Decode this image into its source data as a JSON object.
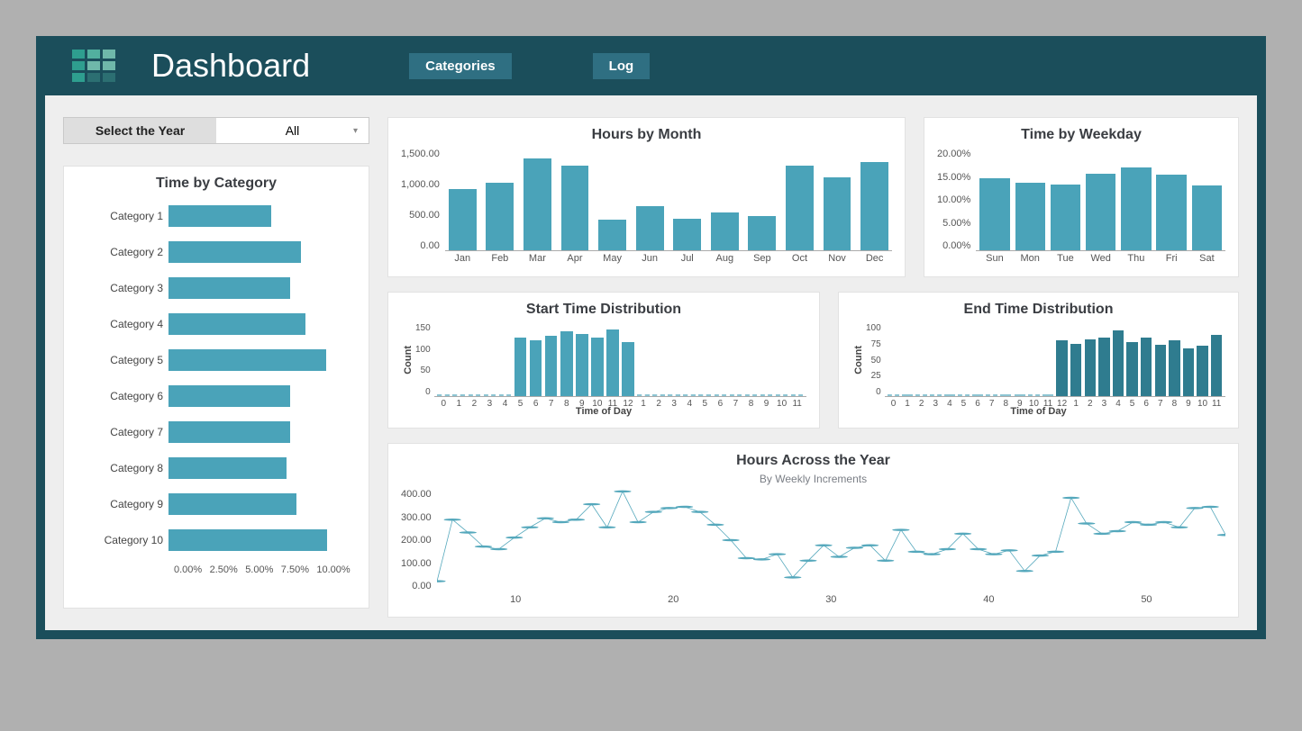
{
  "header": {
    "title": "Dashboard",
    "nav": {
      "categories": "Categories",
      "log": "Log"
    }
  },
  "selector": {
    "label": "Select the Year",
    "value": "All"
  },
  "colors": {
    "bar": "#4aa3b9",
    "bar_dark": "#2f7c8f",
    "line": "#55a8bc"
  },
  "chart_data": [
    {
      "id": "time_by_category",
      "type": "bar",
      "orientation": "horizontal",
      "title": "Time by Category",
      "xlabel": "",
      "ylabel": "",
      "xlim": [
        0,
        12.5
      ],
      "x_ticks": [
        "0.00%",
        "2.50%",
        "5.00%",
        "7.50%",
        "10.00%"
      ],
      "categories": [
        "Category 1",
        "Category 2",
        "Category 3",
        "Category 4",
        "Category 5",
        "Category 6",
        "Category 7",
        "Category 8",
        "Category 9",
        "Category 10"
      ],
      "values": [
        7.0,
        9.0,
        8.3,
        9.3,
        10.7,
        8.3,
        8.3,
        8.0,
        8.7,
        10.8
      ]
    },
    {
      "id": "hours_by_month",
      "type": "bar",
      "title": "Hours by Month",
      "xlabel": "",
      "ylabel": "",
      "ylim": [
        0,
        1500
      ],
      "y_ticks": [
        "1,500.00",
        "1,000.00",
        "500.00",
        "0.00"
      ],
      "categories": [
        "Jan",
        "Feb",
        "Mar",
        "Apr",
        "May",
        "Jun",
        "Jul",
        "Aug",
        "Sep",
        "Oct",
        "Nov",
        "Dec"
      ],
      "values": [
        900,
        1000,
        1350,
        1250,
        450,
        650,
        470,
        560,
        510,
        1250,
        1070,
        1300
      ]
    },
    {
      "id": "time_by_weekday",
      "type": "bar",
      "title": "Time by Weekday",
      "xlabel": "",
      "ylabel": "",
      "ylim": [
        0,
        20
      ],
      "y_ticks": [
        "20.00%",
        "15.00%",
        "10.00%",
        "5.00%",
        "0.00%"
      ],
      "categories": [
        "Sun",
        "Mon",
        "Tue",
        "Wed",
        "Thu",
        "Fri",
        "Sat"
      ],
      "values": [
        14.2,
        13.3,
        12.9,
        15.0,
        16.2,
        14.9,
        12.7
      ]
    },
    {
      "id": "start_time_distribution",
      "type": "bar",
      "title": "Start Time Distribution",
      "xlabel": "Time of Day",
      "ylabel": "Count",
      "ylim": [
        0,
        175
      ],
      "y_ticks": [
        "150",
        "100",
        "50",
        "0"
      ],
      "categories": [
        "0",
        "1",
        "2",
        "3",
        "4",
        "5",
        "6",
        "7",
        "8",
        "9",
        "10",
        "11",
        "12",
        "1",
        "2",
        "3",
        "4",
        "5",
        "6",
        "7",
        "8",
        "9",
        "10",
        "11"
      ],
      "values": [
        0,
        0,
        0,
        0,
        0,
        140,
        135,
        145,
        155,
        150,
        140,
        160,
        130,
        0,
        0,
        0,
        0,
        0,
        0,
        0,
        0,
        0,
        0,
        0
      ]
    },
    {
      "id": "end_time_distribution",
      "type": "bar",
      "title": "End Time Distribution",
      "xlabel": "Time of Day",
      "ylabel": "Count",
      "ylim": [
        0,
        125
      ],
      "y_ticks": [
        "100",
        "75",
        "50",
        "25",
        "0"
      ],
      "categories": [
        "0",
        "1",
        "2",
        "3",
        "4",
        "5",
        "6",
        "7",
        "8",
        "9",
        "10",
        "11",
        "12",
        "1",
        "2",
        "3",
        "4",
        "5",
        "6",
        "7",
        "8",
        "9",
        "10",
        "11"
      ],
      "values": [
        0,
        0,
        0,
        0,
        0,
        0,
        0,
        0,
        0,
        0,
        0,
        0,
        95,
        90,
        98,
        100,
        112,
        92,
        100,
        88,
        95,
        82,
        86,
        105
      ]
    },
    {
      "id": "hours_across_year",
      "type": "line",
      "title": "Hours Across the Year",
      "subtitle": "By Weekly Increments",
      "xlabel": "",
      "ylabel": "",
      "ylim": [
        0,
        400
      ],
      "y_ticks": [
        "400.00",
        "300.00",
        "200.00",
        "100.00",
        "0.00"
      ],
      "x_ticks": [
        "10",
        "20",
        "30",
        "40",
        "50"
      ],
      "x": [
        1,
        2,
        3,
        4,
        5,
        6,
        7,
        8,
        9,
        10,
        11,
        12,
        13,
        14,
        15,
        16,
        17,
        18,
        19,
        20,
        21,
        22,
        23,
        24,
        25,
        26,
        27,
        28,
        29,
        30,
        31,
        32,
        33,
        34,
        35,
        36,
        37,
        38,
        39,
        40,
        41,
        42,
        43,
        44,
        45,
        46,
        47,
        48,
        49,
        50,
        51,
        52
      ],
      "values": [
        40,
        280,
        230,
        175,
        165,
        210,
        250,
        285,
        270,
        280,
        340,
        250,
        390,
        270,
        310,
        325,
        330,
        310,
        260,
        200,
        130,
        125,
        145,
        55,
        120,
        180,
        135,
        170,
        180,
        120,
        240,
        155,
        145,
        165,
        225,
        165,
        145,
        160,
        80,
        140,
        155,
        365,
        265,
        225,
        235,
        270,
        260,
        270,
        250,
        325,
        330,
        220
      ]
    }
  ]
}
